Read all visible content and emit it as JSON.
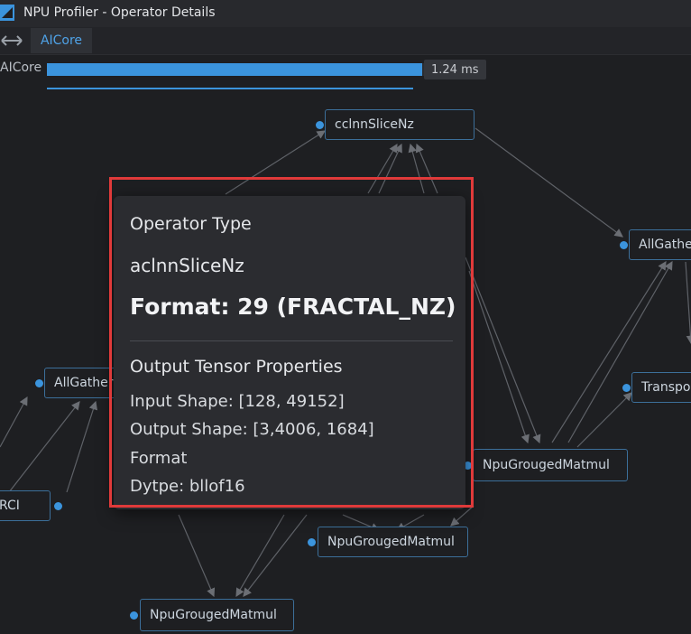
{
  "window": {
    "title": "NPU Profiler - Operator Details"
  },
  "tabs": [
    {
      "label": "AICore",
      "active": true
    }
  ],
  "timeline": {
    "label": "AICore",
    "duration": "1.24 ms",
    "progress": 0.86,
    "accent": "#3b94dd"
  },
  "graph": {
    "nodes": [
      {
        "label": "cclnnSliceNz"
      },
      {
        "label": "AllGather"
      },
      {
        "label": "AllGather"
      },
      {
        "label": "Transpose"
      },
      {
        "label": "NpuGrougedMatmul"
      },
      {
        "label": "NpuGrougedMatmul"
      },
      {
        "label": "NpuGrougedMatmul"
      },
      {
        "label": "RCI"
      }
    ]
  },
  "tooltip": {
    "operator_type_heading": "Operator Type",
    "operator_name": "aclnnSliceNz",
    "format_line": "Format: 29 (FRACTAL_NZ)",
    "output_heading": "Output Tensor Properties",
    "input_shape": "Input Shape: [128, 49152]",
    "output_shape": "Output Shape: [3,4006, 1684]",
    "format_label": "Format",
    "dtype": "Dytpe: bllof16",
    "highlight_color": "#e03a3a"
  }
}
